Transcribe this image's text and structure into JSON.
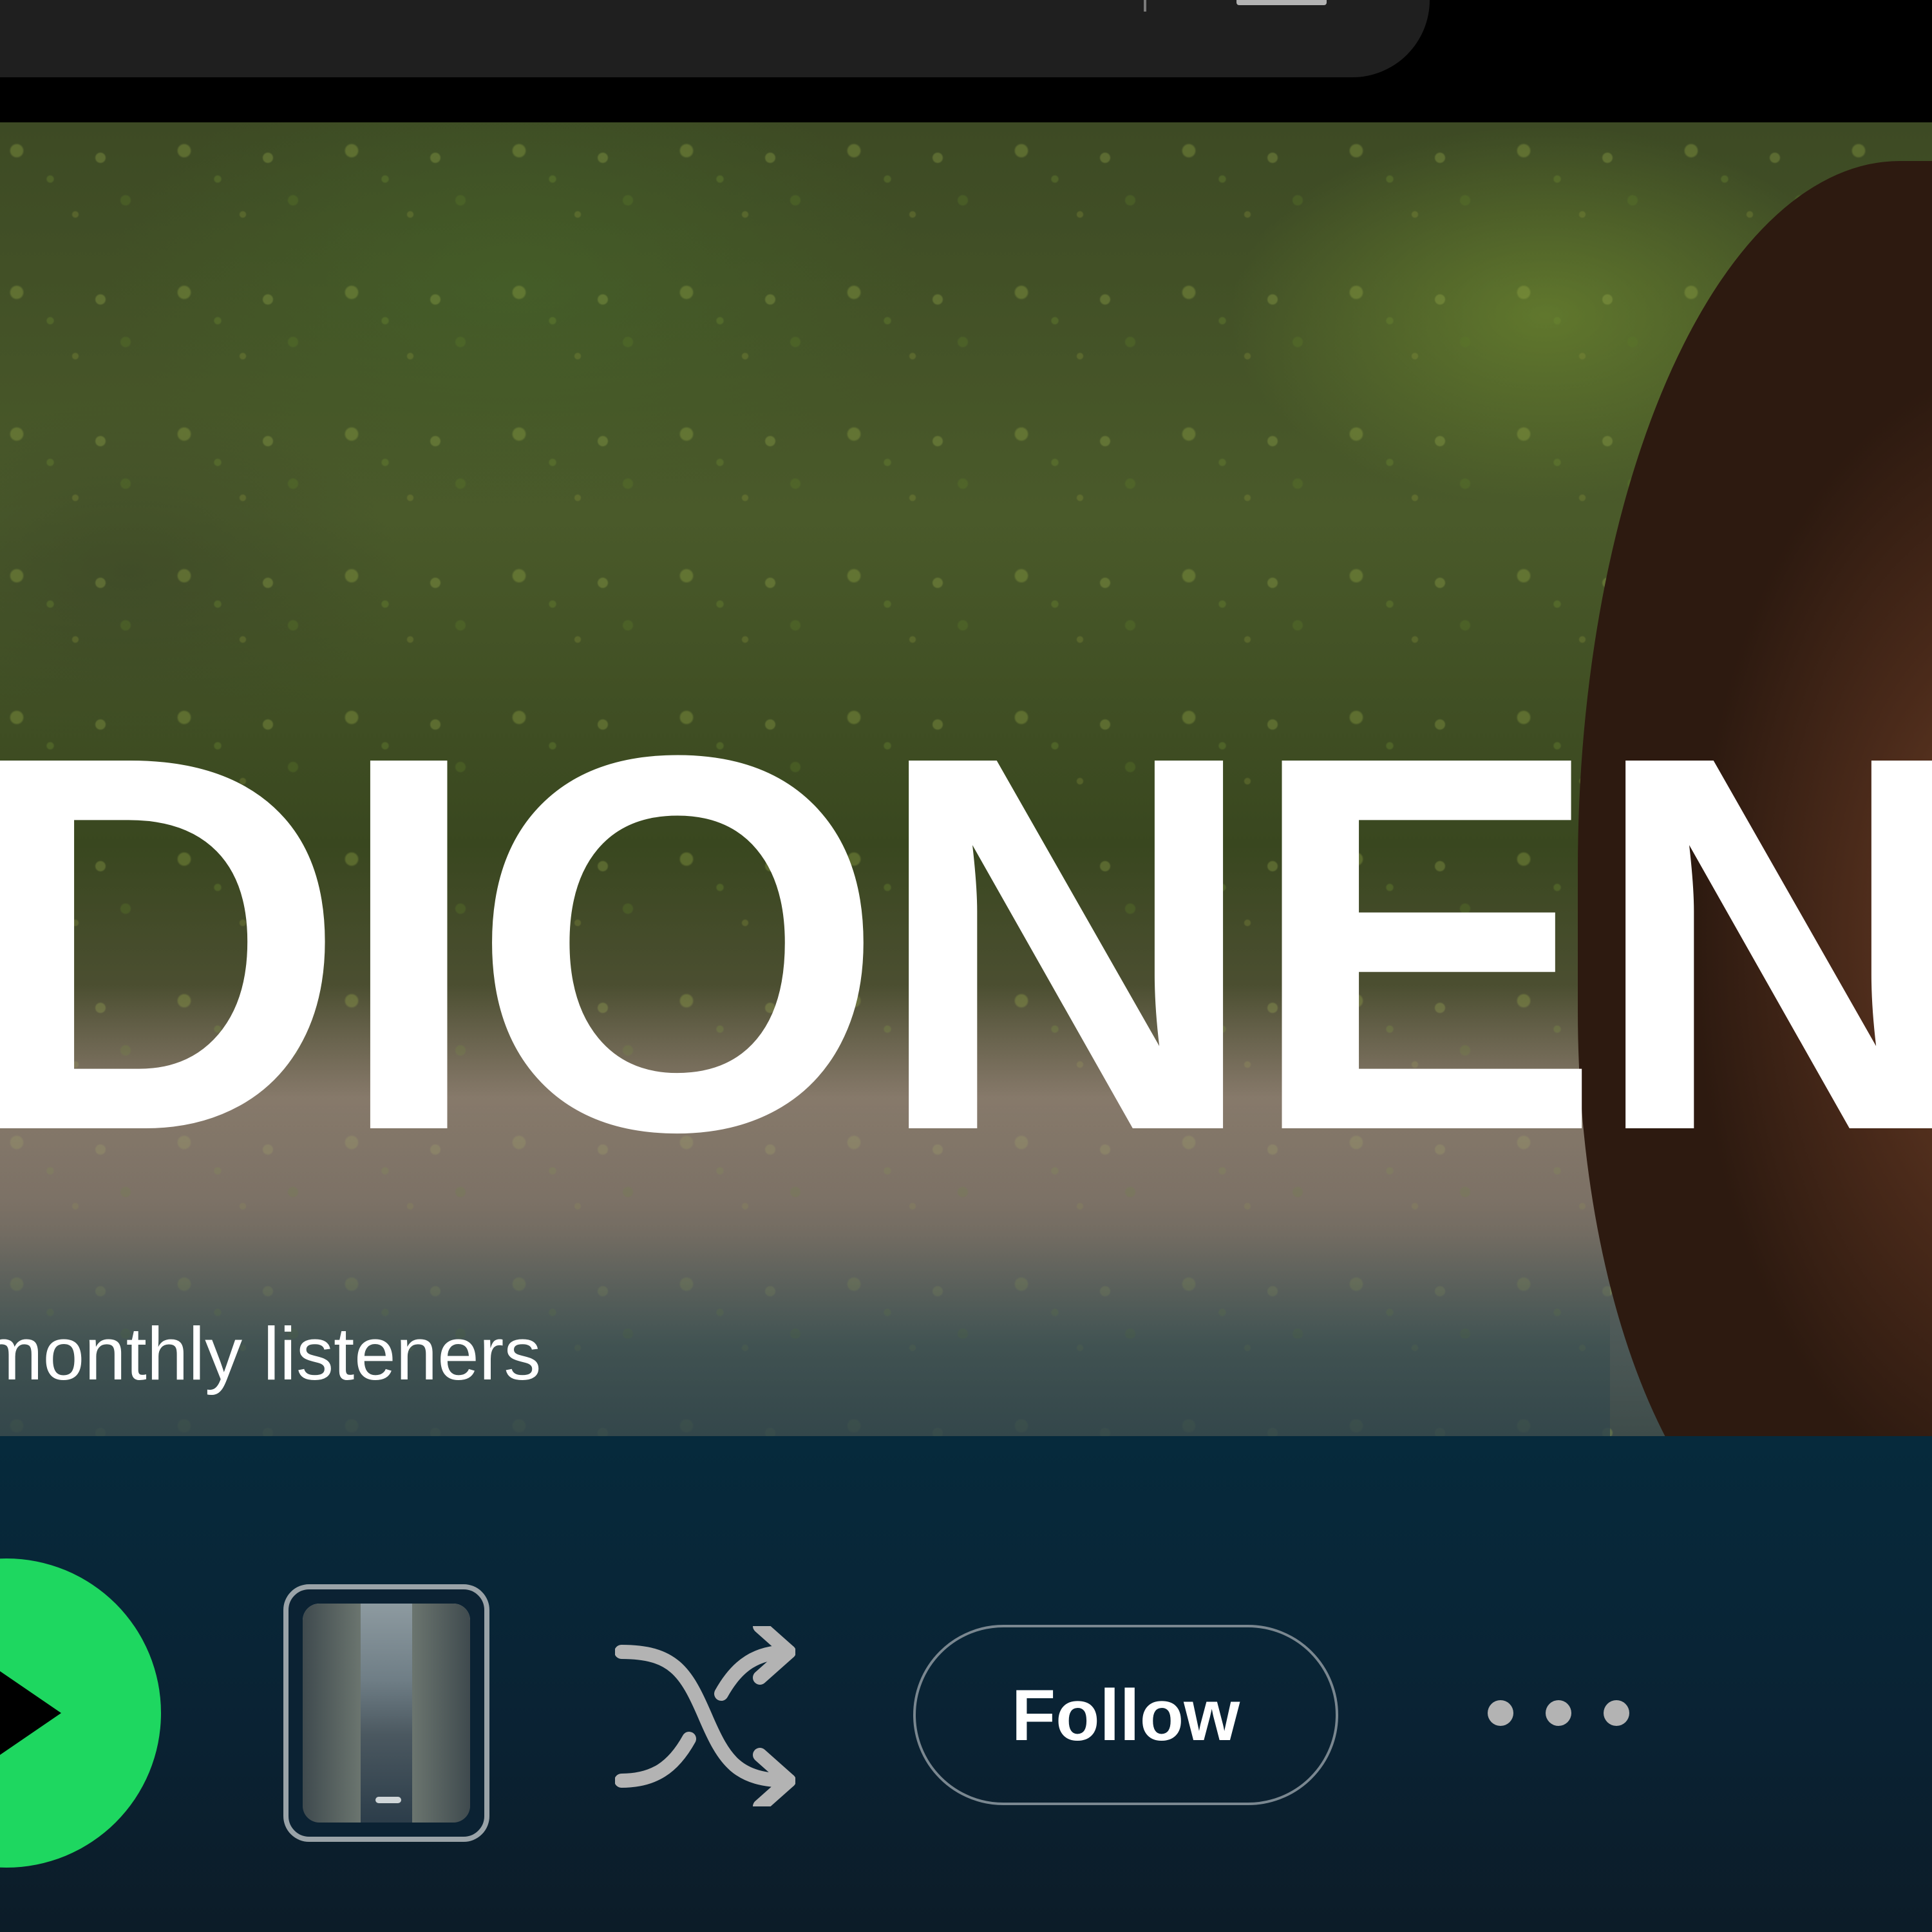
{
  "artist": {
    "name": "DIONENG",
    "listeners_text": "monthly listeners"
  },
  "actions": {
    "follow_label": "Follow"
  },
  "icons": {
    "play": "play-icon",
    "shuffle": "shuffle-icon",
    "more": "more-options-icon",
    "preview": "video-preview-thumbnail"
  },
  "colors": {
    "accent_green": "#1ed760",
    "action_bar_bg": "#062a3c",
    "text_primary": "#ffffff",
    "icon_muted": "#b3b3b3"
  }
}
